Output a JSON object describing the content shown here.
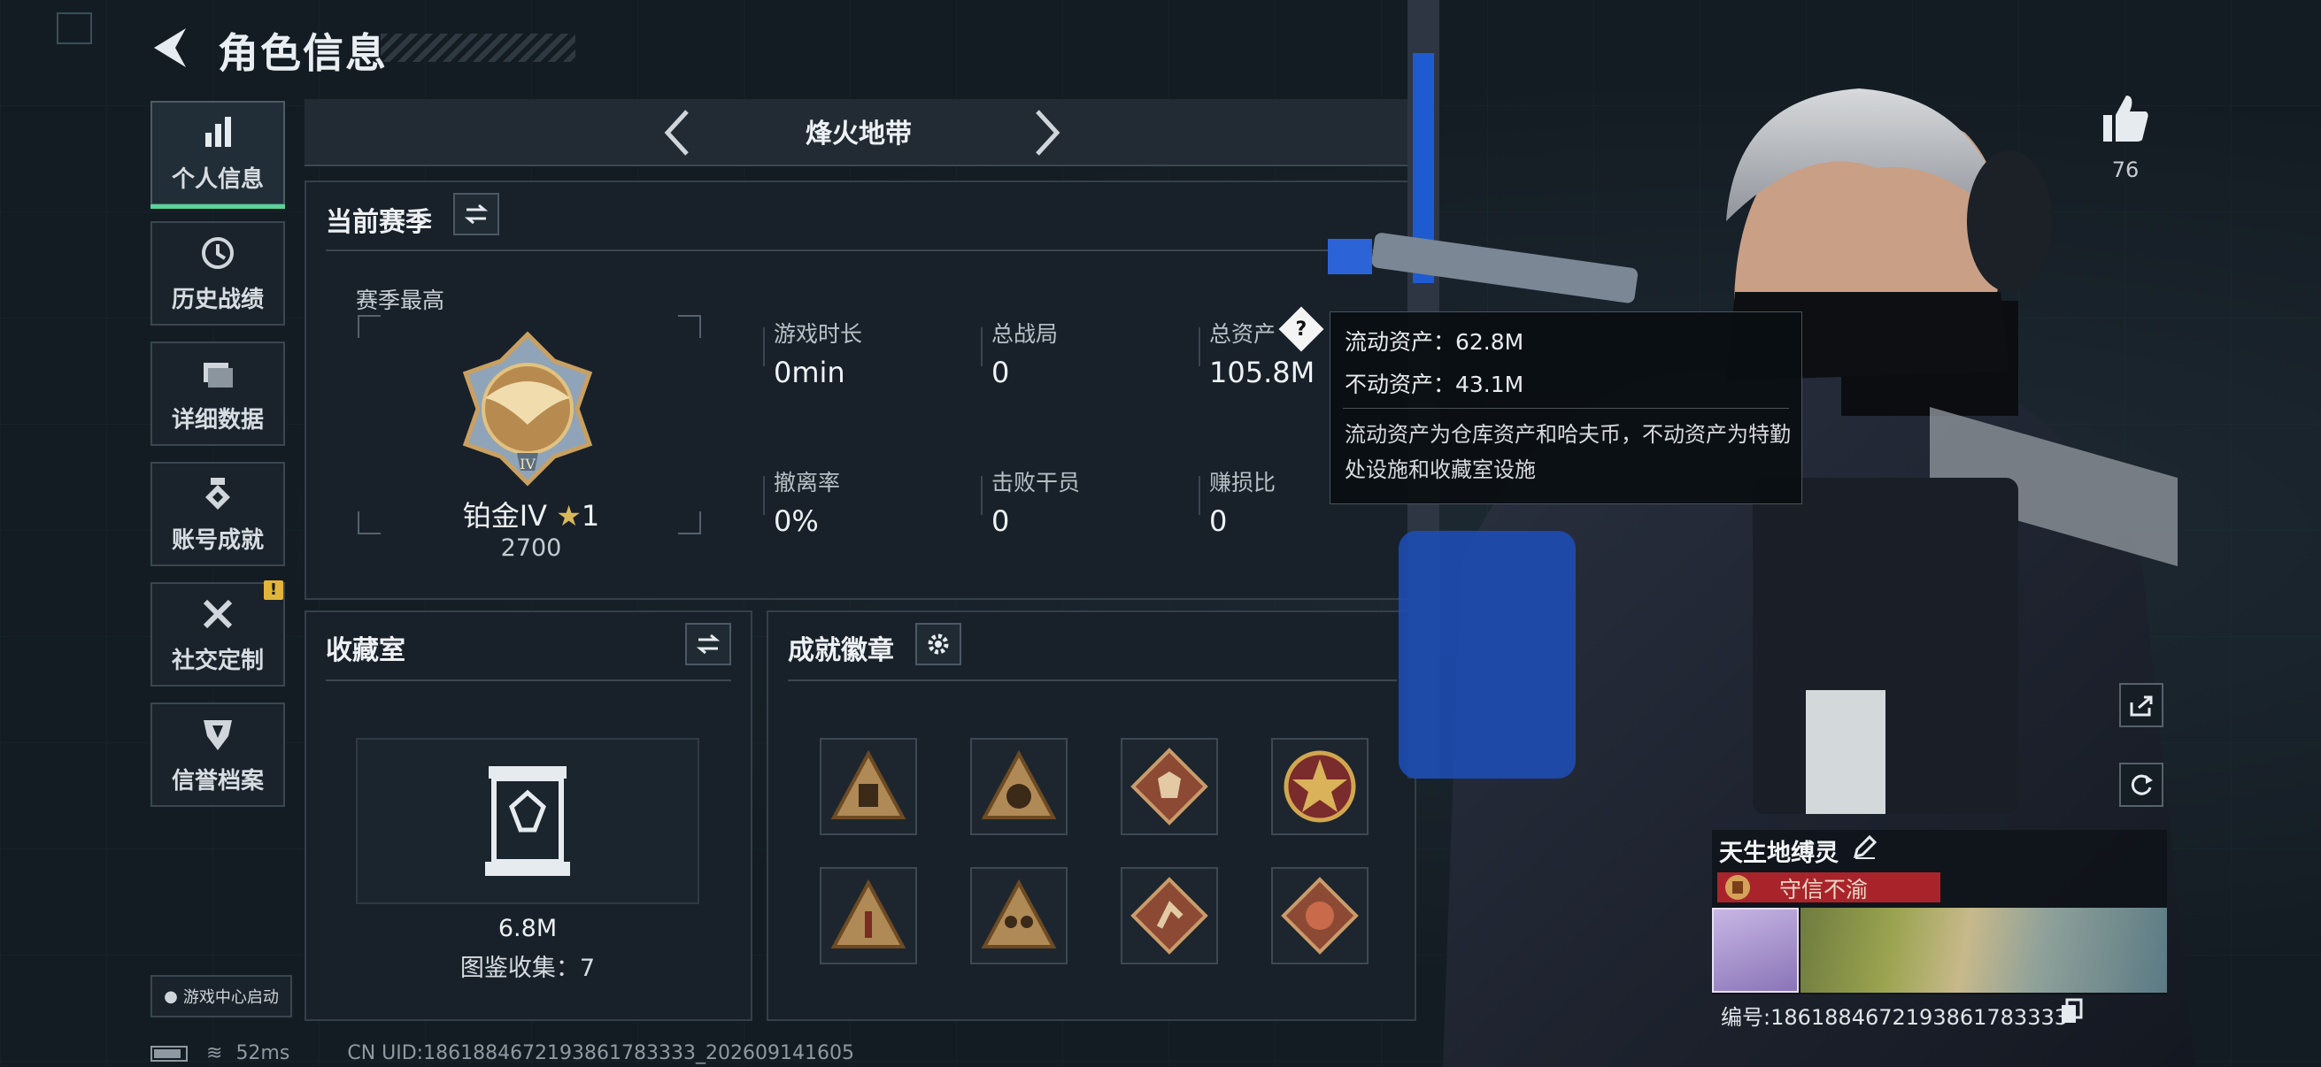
{
  "header": {
    "title": "角色信息",
    "back_icon": "back-arrow-icon"
  },
  "sidebar": {
    "items": [
      {
        "label": "个人信息",
        "icon": "bar-chart-icon",
        "active": true
      },
      {
        "label": "历史战绩",
        "icon": "clock-icon",
        "active": false
      },
      {
        "label": "详细数据",
        "icon": "folder-icon",
        "active": false
      },
      {
        "label": "账号成就",
        "icon": "medal-icon",
        "active": false
      },
      {
        "label": "社交定制",
        "icon": "tools-icon",
        "active": false,
        "badge": "!"
      },
      {
        "label": "信誉档案",
        "icon": "shield-icon",
        "active": false
      }
    ],
    "launch_label": "游戏中心启动"
  },
  "mode": {
    "title": "烽火地带"
  },
  "season": {
    "title": "当前赛季",
    "highest_label": "赛季最高",
    "rank": "铂金IV",
    "stars": "1",
    "score": "2700",
    "stats": [
      {
        "label": "游戏时长",
        "value": "0min"
      },
      {
        "label": "总战局",
        "value": "0"
      },
      {
        "label": "总资产",
        "value": "105.8M"
      },
      {
        "label": "撤离率",
        "value": "0%"
      },
      {
        "label": "击败干员",
        "value": "0"
      },
      {
        "label": "赚损比",
        "value": "0"
      }
    ]
  },
  "tooltip": {
    "liquid": "流动资产：62.8M",
    "fixed": "不动资产：43.1M",
    "desc": "流动资产为仓库资产和哈夫币，不动资产为特勤处设施和收藏室设施"
  },
  "collection": {
    "title": "收藏室",
    "value": "6.8M",
    "catalog": "图鉴收集：7"
  },
  "achievements": {
    "title": "成就徽章",
    "badge_count": 8
  },
  "profile": {
    "likes": "76",
    "name": "天生地缚灵",
    "title": "守信不渝",
    "uid": "编号:1861884672193861783333"
  },
  "status": {
    "ping": "52ms",
    "uid_line": "CN UID:1861884672193861783333_202609141605"
  },
  "colors": {
    "accent": "#59d39a",
    "title_band": "#a9242a",
    "warn": "#e2b53a"
  }
}
